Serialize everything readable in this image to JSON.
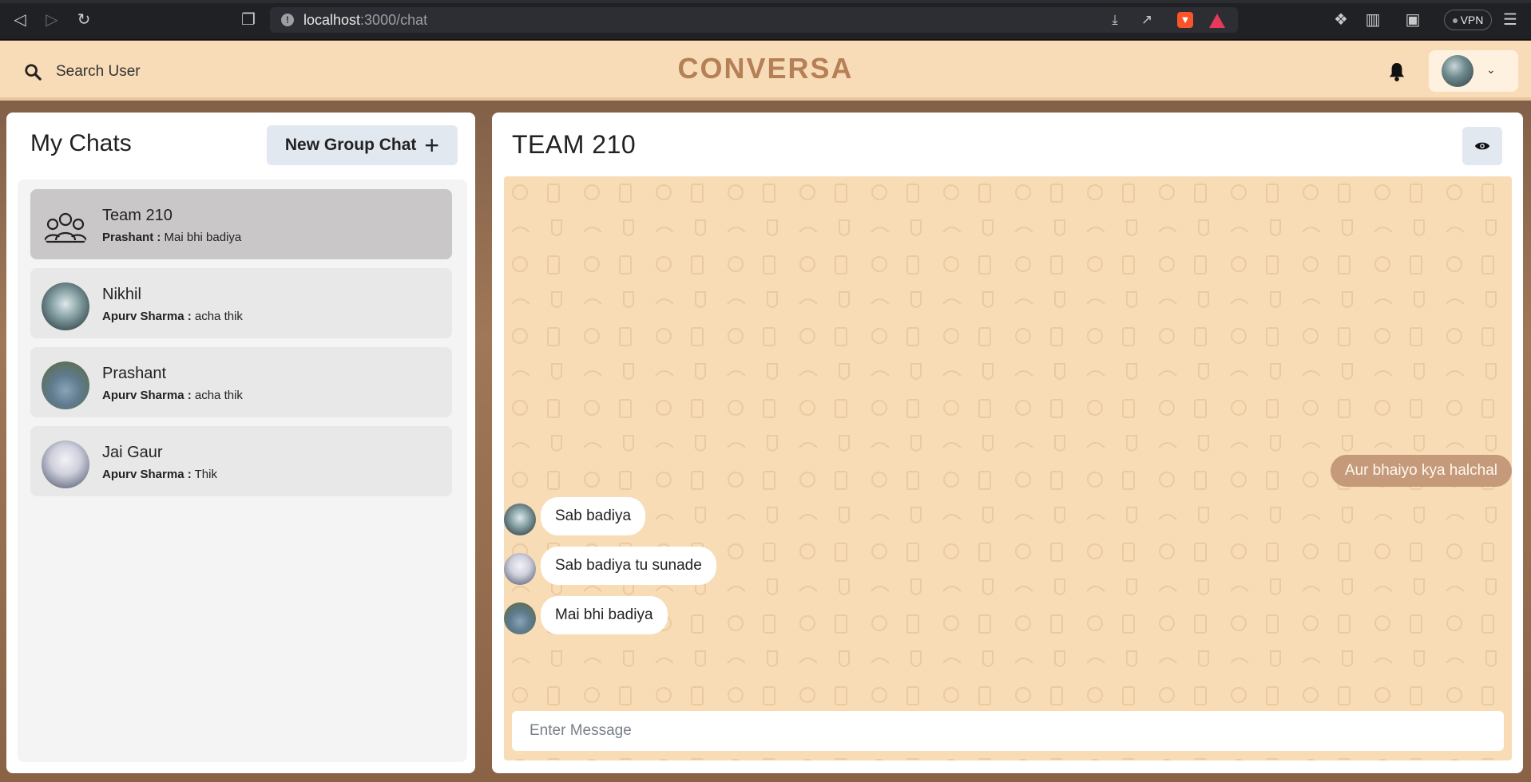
{
  "browser": {
    "url_host": "localhost",
    "url_path": ":3000/chat",
    "vpn_label": "VPN"
  },
  "header": {
    "search_label": "Search User",
    "brand": "CONVERSA"
  },
  "sidebar": {
    "title": "My Chats",
    "new_group_label": "New Group Chat",
    "chats": [
      {
        "name": "Team 210",
        "sender": "Prashant :",
        "last": "Mai bhi badiya",
        "active": true
      },
      {
        "name": "Nikhil",
        "sender": "Apurv Sharma :",
        "last": "acha thik"
      },
      {
        "name": "Prashant",
        "sender": "Apurv Sharma :",
        "last": "acha thik"
      },
      {
        "name": "Jai Gaur",
        "sender": "Apurv Sharma :",
        "last": "Thik"
      }
    ]
  },
  "chat": {
    "title": "TEAM 210",
    "messages": {
      "sent": "Aur bhaiyo kya halchal",
      "received": [
        "Sab badiya",
        "Sab badiya tu sunade",
        "Mai bhi badiya"
      ]
    },
    "input_placeholder": "Enter Message"
  },
  "icons": [
    "back-icon",
    "forward-icon",
    "reload-icon",
    "bookmark-icon",
    "info-icon",
    "download-icon",
    "share-icon",
    "brave-icon",
    "rewards-icon",
    "extensions-icon",
    "sidebar-icon",
    "wallet-icon",
    "menu-icon",
    "search-icon",
    "bell-icon",
    "chevron-down-icon",
    "group-icon",
    "plus-icon",
    "eye-icon"
  ],
  "colors": {
    "header_bg": "#f8dcb8",
    "brand": "#b58055",
    "chat_bg": "#f8dcb6",
    "sent_bubble": "#c49a7a"
  }
}
